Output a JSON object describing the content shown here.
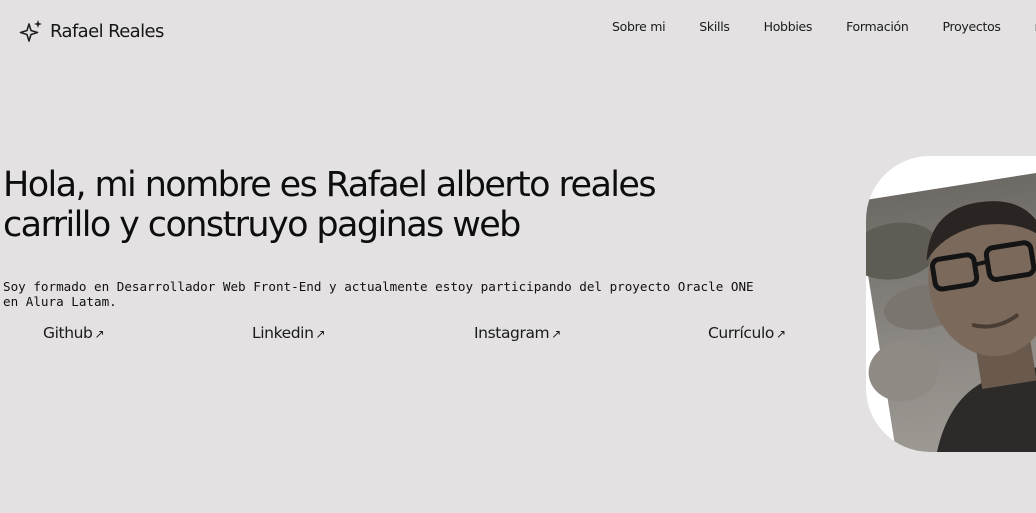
{
  "header": {
    "brand_icon": "sparkles-icon",
    "brand_name": "Rafael Reales",
    "nav": [
      "Sobre mi",
      "Skills",
      "Hobbies",
      "Formación",
      "Proyectos",
      "ra"
    ]
  },
  "hero": {
    "headline_line1": "Hola, mi nombre es Rafael alberto reales",
    "headline_line2": "carrillo y construyo paginas web",
    "intro_line1": "Soy formado en Desarrollador Web Front-End y actualmente estoy participando del proyecto Oracle ONE",
    "intro_line2": "en Alura Latam.",
    "links": [
      {
        "label": "Github",
        "arrow": "↗"
      },
      {
        "label": "Linkedin",
        "arrow": "↗"
      },
      {
        "label": "Instagram",
        "arrow": "↗"
      },
      {
        "label": "Currículo",
        "arrow": "↗"
      }
    ]
  },
  "colors": {
    "background": "#e3e1e2",
    "text": "#111111",
    "photo_frame": "#ffffff"
  }
}
